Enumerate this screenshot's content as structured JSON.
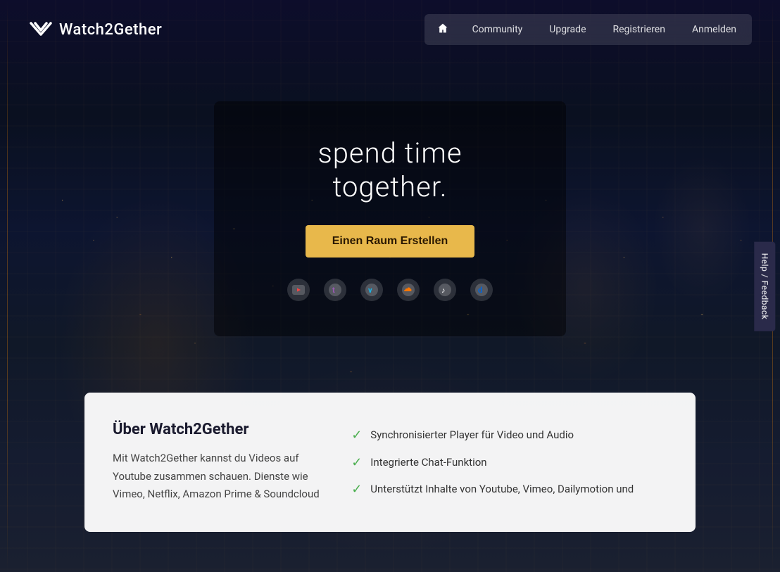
{
  "logo": {
    "text": "Watch2Gether"
  },
  "nav": {
    "home_label": "🏠",
    "community_label": "Community",
    "upgrade_label": "Upgrade",
    "registrieren_label": "Registrieren",
    "anmelden_label": "Anmelden"
  },
  "hero": {
    "title": "spend time together.",
    "cta_label": "Einen Raum Erstellen"
  },
  "services": {
    "youtube": "▶",
    "twitch": "t",
    "vimeo": "v",
    "soundcloud": "☁",
    "tiktok": "♪",
    "dailymotion": "d"
  },
  "info": {
    "title": "Über Watch2Gether",
    "text": "Mit Watch2Gether kannst du Videos auf Youtube zusammen schauen. Dienste wie Vimeo, Netflix, Amazon Prime & Soundcloud",
    "features": [
      "Synchronisierter Player für Video und Audio",
      "Integrierte Chat-Funktion",
      "Unterstützt Inhalte von Youtube, Vimeo, Dailymotion und"
    ]
  },
  "feedback": {
    "label": "Help / Feedback"
  }
}
